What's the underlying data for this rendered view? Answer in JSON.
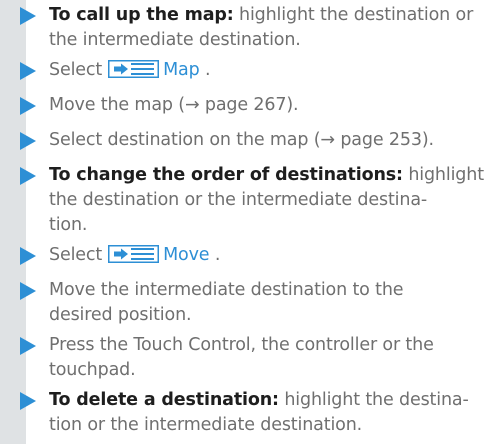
{
  "steps": [
    {
      "lead": "To call up the map:",
      "lines": [
        " highlight the destination or",
        "the intermediate destination."
      ]
    },
    {
      "prefix": "Select",
      "icon": "menu-icon",
      "ui": "Map",
      "suffix": "."
    },
    {
      "lines": [
        "Move the map (→ page 267)."
      ]
    },
    {
      "lines": [
        "Select destination on the map (→ page 253)."
      ]
    },
    {
      "lead": "To change the order of destinations:",
      "lines": [
        " highlight",
        "the destination or the intermediate destina-",
        "tion."
      ]
    },
    {
      "prefix": "Select",
      "icon": "menu-icon",
      "ui": "Move",
      "suffix": "."
    },
    {
      "lines": [
        "Move the intermediate destination to the",
        "desired position."
      ]
    },
    {
      "lines": [
        "Press the Touch Control, the controller or the",
        "touchpad."
      ]
    },
    {
      "lead": "To delete a destination:",
      "lines": [
        " highlight the destina-",
        "tion or the intermediate destination."
      ]
    }
  ],
  "colors": {
    "arrow": "#2d8fd5",
    "ui_text": "#2d8fd5",
    "body_text": "#6f6f6f",
    "lead_text": "#1e1e1e",
    "stripe": "#dfe2e4"
  }
}
